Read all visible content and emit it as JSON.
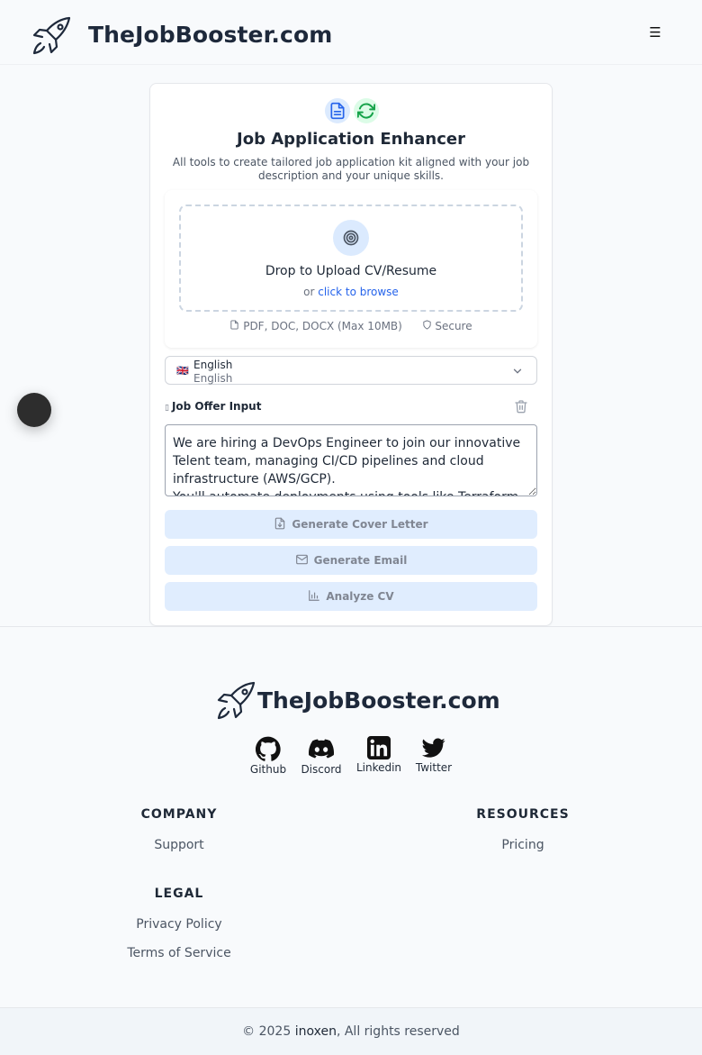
{
  "header": {
    "brand": "TheJobBooster.com",
    "menu_icon": "☰"
  },
  "hero": {
    "title": "Job Application Enhancer",
    "subtitle": "All tools to create tailored job application kit aligned with your job description and your unique skills."
  },
  "upload": {
    "title": "Drop to Upload CV/Resume",
    "or_text": "or ",
    "browse_link": "click to browse",
    "formats": "PDF, DOC, DOCX (Max 10MB)",
    "secure": "Secure"
  },
  "language": {
    "flag_text": "🇬🇧",
    "selected": "English",
    "native": "English"
  },
  "job_offer": {
    "label": "Job Offer Input",
    "text": "We are hiring a DevOps Engineer to join our innovative Telent team, managing CI/CD pipelines and cloud infrastructure (AWS/GCP).\nYou'll automate deployments using tools like Terraform"
  },
  "actions": {
    "cover_letter": "Generate Cover Letter",
    "email": "Generate Email",
    "analyze": "Analyze CV"
  },
  "footer": {
    "brand": "TheJobBooster.com",
    "socials": [
      "Github",
      "Discord",
      "Linkedin",
      "Twitter"
    ],
    "company": {
      "title": "COMPANY",
      "links": [
        "Support"
      ]
    },
    "resources": {
      "title": "RESOURCES",
      "links": [
        "Pricing"
      ]
    },
    "legal": {
      "title": "LEGAL",
      "links": [
        "Privacy Policy",
        "Terms of Service"
      ]
    }
  },
  "copyright": {
    "prefix": "© 2025 ",
    "owner": "inoxen",
    "suffix": ", All rights reserved"
  },
  "colors": {
    "primary": "#2563eb",
    "button_bg": "#dbeafe",
    "icon_green": "#16a34a",
    "text_dark": "#1e293b"
  },
  "icons": [
    "rocket-icon",
    "menu-icon",
    "document-icon",
    "refresh-icon",
    "target-icon",
    "file-icon",
    "shield-icon",
    "flag-icon",
    "chevron-down-icon",
    "trash-icon",
    "file-download-icon",
    "mail-icon",
    "bar-chart-icon",
    "github-icon",
    "discord-icon",
    "linkedin-icon",
    "twitter-icon"
  ]
}
